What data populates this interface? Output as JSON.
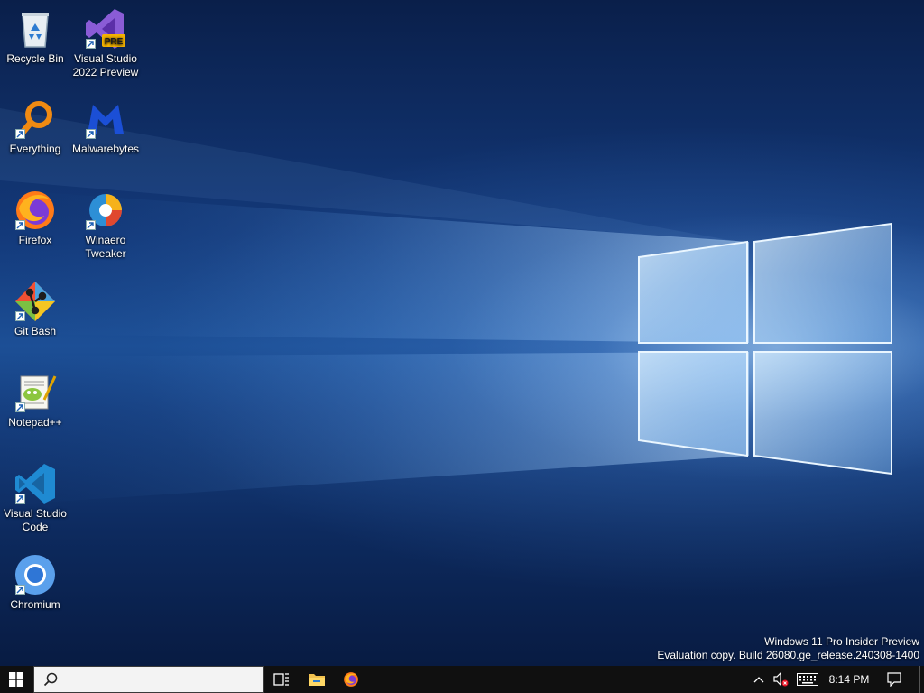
{
  "desktop": {
    "icons": [
      {
        "label_line1": "Recycle Bin",
        "label_line2": "",
        "icon": "recycle-bin-icon",
        "shortcut": false
      },
      {
        "label_line1": "Visual Studio",
        "label_line2": "2022 Preview",
        "icon": "visual-studio-preview-icon",
        "badge": "PRE",
        "shortcut": true
      },
      {
        "label_line1": "Everything",
        "label_line2": "",
        "icon": "everything-search-icon",
        "shortcut": true
      },
      {
        "label_line1": "Malwarebytes",
        "label_line2": "",
        "icon": "malwarebytes-icon",
        "shortcut": true
      },
      {
        "label_line1": "Firefox",
        "label_line2": "",
        "icon": "firefox-icon",
        "shortcut": true
      },
      {
        "label_line1": "Winaero",
        "label_line2": "Tweaker",
        "icon": "winaero-tweaker-icon",
        "shortcut": true
      },
      {
        "label_line1": "Git Bash",
        "label_line2": "",
        "icon": "git-bash-icon",
        "shortcut": true
      },
      {
        "label_line1": "Notepad++",
        "label_line2": "",
        "icon": "notepad-plus-plus-icon",
        "shortcut": true
      },
      {
        "label_line1": "Visual Studio",
        "label_line2": "Code",
        "icon": "vscode-icon",
        "shortcut": true
      },
      {
        "label_line1": "Chromium",
        "label_line2": "",
        "icon": "chromium-icon",
        "shortcut": true
      }
    ],
    "watermark": {
      "line1": "Windows 11 Pro Insider Preview",
      "line2": "Evaluation copy. Build 26080.ge_release.240308-1400"
    }
  },
  "taskbar": {
    "search_value": "",
    "search_placeholder": "",
    "pinned": [
      "task-view-icon",
      "file-explorer-icon",
      "firefox-icon"
    ],
    "clock": "8:14 PM",
    "tray_icons": [
      "chevron-up-icon",
      "volume-muted-icon",
      "touch-keyboard-icon",
      "notification-icon"
    ]
  },
  "colors": {
    "taskbar": "#101010",
    "wallpaper_deep": "#0a1f4a",
    "wallpaper_mid": "#1c4f96",
    "light_beam": "#bfe0ff"
  }
}
